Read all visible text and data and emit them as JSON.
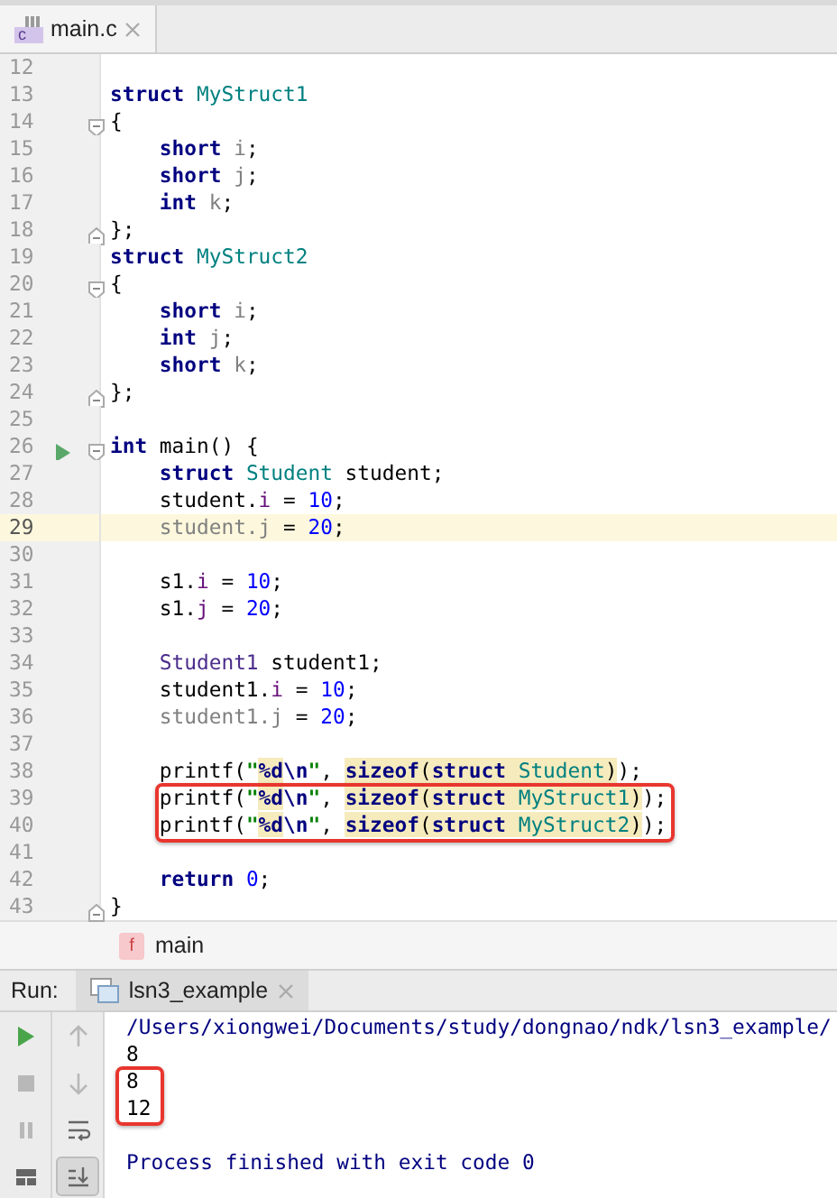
{
  "editor_tab": {
    "icon_text": "c",
    "label": "main.c",
    "selected": true
  },
  "code_lines": [
    {
      "number": "12",
      "kind": "plain",
      "current": false,
      "boxed": false
    },
    {
      "number": "13",
      "kind": "plain",
      "current": false,
      "boxed": false,
      "tokens": [
        {
          "text": "struct ",
          "kind": "kw"
        },
        {
          "text": "MyStruct1",
          "kind": "type"
        }
      ]
    },
    {
      "number": "14",
      "kind": "opener",
      "current": false,
      "boxed": false,
      "tokens": [
        {
          "text": "{",
          "kind": "plain"
        }
      ]
    },
    {
      "number": "15",
      "kind": "plain",
      "current": false,
      "boxed": false,
      "tokens": [
        {
          "text": "    short ",
          "kind": "kw"
        },
        {
          "text": "i",
          "kind": "dim"
        },
        {
          "text": ";",
          "kind": "plain"
        }
      ]
    },
    {
      "number": "16",
      "kind": "plain",
      "current": false,
      "boxed": false,
      "tokens": [
        {
          "text": "    short ",
          "kind": "kw"
        },
        {
          "text": "j",
          "kind": "dim"
        },
        {
          "text": ";",
          "kind": "plain"
        }
      ]
    },
    {
      "number": "17",
      "kind": "plain",
      "current": false,
      "boxed": false,
      "tokens": [
        {
          "text": "    int ",
          "kind": "kw"
        },
        {
          "text": "k",
          "kind": "dim"
        },
        {
          "text": ";",
          "kind": "plain"
        }
      ]
    },
    {
      "number": "18",
      "kind": "closer",
      "current": false,
      "boxed": false,
      "tokens": [
        {
          "text": "};",
          "kind": "plain"
        }
      ]
    },
    {
      "number": "19",
      "kind": "plain",
      "current": false,
      "boxed": false,
      "tokens": [
        {
          "text": "struct ",
          "kind": "kw"
        },
        {
          "text": "MyStruct2",
          "kind": "type"
        }
      ]
    },
    {
      "number": "20",
      "kind": "opener",
      "current": false,
      "boxed": false,
      "tokens": [
        {
          "text": "{",
          "kind": "plain"
        }
      ]
    },
    {
      "number": "21",
      "kind": "plain",
      "current": false,
      "boxed": false,
      "tokens": [
        {
          "text": "    short ",
          "kind": "kw"
        },
        {
          "text": "i",
          "kind": "dim"
        },
        {
          "text": ";",
          "kind": "plain"
        }
      ]
    },
    {
      "number": "22",
      "kind": "plain",
      "current": false,
      "boxed": false,
      "tokens": [
        {
          "text": "    int ",
          "kind": "kw"
        },
        {
          "text": "j",
          "kind": "dim"
        },
        {
          "text": ";",
          "kind": "plain"
        }
      ]
    },
    {
      "number": "23",
      "kind": "plain",
      "current": false,
      "boxed": false,
      "tokens": [
        {
          "text": "    short ",
          "kind": "kw"
        },
        {
          "text": "k",
          "kind": "dim"
        },
        {
          "text": ";",
          "kind": "plain"
        }
      ]
    },
    {
      "number": "24",
      "kind": "closer",
      "current": false,
      "boxed": false,
      "tokens": [
        {
          "text": "};",
          "kind": "plain"
        }
      ]
    },
    {
      "number": "25",
      "kind": "plain",
      "current": false,
      "boxed": false
    },
    {
      "number": "26",
      "kind": "opener",
      "current": false,
      "boxed": false,
      "run": true,
      "tokens": [
        {
          "text": "int",
          "kind": "kw"
        },
        {
          "text": " main() {",
          "kind": "plain"
        }
      ]
    },
    {
      "number": "27",
      "kind": "plain",
      "current": false,
      "boxed": false,
      "tokens": [
        {
          "text": "    struct ",
          "kind": "kw"
        },
        {
          "text": "Student",
          "kind": "type"
        },
        {
          "text": " student;",
          "kind": "plain"
        }
      ]
    },
    {
      "number": "28",
      "kind": "plain",
      "current": false,
      "boxed": false,
      "tokens": [
        {
          "text": "    student.",
          "kind": "plain"
        },
        {
          "text": "i",
          "kind": "field"
        },
        {
          "text": " = ",
          "kind": "plain"
        },
        {
          "text": "10",
          "kind": "num"
        },
        {
          "text": ";",
          "kind": "plain"
        }
      ]
    },
    {
      "number": "29",
      "kind": "plain",
      "current": true,
      "boxed": false,
      "tokens": [
        {
          "text": "    student.j",
          "kind": "dim"
        },
        {
          "text": " = ",
          "kind": "plain"
        },
        {
          "text": "20",
          "kind": "num"
        },
        {
          "text": ";",
          "kind": "plain"
        }
      ]
    },
    {
      "number": "30",
      "kind": "plain",
      "current": false,
      "boxed": false
    },
    {
      "number": "31",
      "kind": "plain",
      "current": false,
      "boxed": false,
      "tokens": [
        {
          "text": "    s1.",
          "kind": "plain"
        },
        {
          "text": "i",
          "kind": "field"
        },
        {
          "text": " = ",
          "kind": "plain"
        },
        {
          "text": "10",
          "kind": "num"
        },
        {
          "text": ";",
          "kind": "plain"
        }
      ]
    },
    {
      "number": "32",
      "kind": "plain",
      "current": false,
      "boxed": false,
      "tokens": [
        {
          "text": "    s1.",
          "kind": "plain"
        },
        {
          "text": "j",
          "kind": "field"
        },
        {
          "text": " = ",
          "kind": "plain"
        },
        {
          "text": "20",
          "kind": "num"
        },
        {
          "text": ";",
          "kind": "plain"
        }
      ]
    },
    {
      "number": "33",
      "kind": "plain",
      "current": false,
      "boxed": false
    },
    {
      "number": "34",
      "kind": "plain",
      "current": false,
      "boxed": false,
      "tokens": [
        {
          "text": "    Student1",
          "kind": "alias"
        },
        {
          "text": " student1;",
          "kind": "plain"
        }
      ]
    },
    {
      "number": "35",
      "kind": "plain",
      "current": false,
      "boxed": false,
      "tokens": [
        {
          "text": "    student1.",
          "kind": "plain"
        },
        {
          "text": "i",
          "kind": "field"
        },
        {
          "text": " = ",
          "kind": "plain"
        },
        {
          "text": "10",
          "kind": "num"
        },
        {
          "text": ";",
          "kind": "plain"
        }
      ]
    },
    {
      "number": "36",
      "kind": "plain",
      "current": false,
      "boxed": false,
      "tokens": [
        {
          "text": "    student1.j",
          "kind": "dim"
        },
        {
          "text": " = ",
          "kind": "plain"
        },
        {
          "text": "20",
          "kind": "num"
        },
        {
          "text": ";",
          "kind": "plain"
        }
      ]
    },
    {
      "number": "37",
      "kind": "plain",
      "current": false,
      "boxed": false
    },
    {
      "number": "38",
      "kind": "plain",
      "current": false,
      "boxed": false,
      "tokens": [
        {
          "text": "    printf(",
          "kind": "plain"
        },
        {
          "text": "\"",
          "kind": "str"
        },
        {
          "text": "%d",
          "kind": "escmark"
        },
        {
          "text": "\\n",
          "kind": "esc"
        },
        {
          "text": "\"",
          "kind": "str"
        },
        {
          "text": ", ",
          "kind": "plain"
        },
        {
          "text": "sizeof",
          "kind": "kwmark"
        },
        {
          "text": "(",
          "kind": "plainmark"
        },
        {
          "text": "struct ",
          "kind": "kwmark"
        },
        {
          "text": "Student",
          "kind": "typemark"
        },
        {
          "text": ")",
          "kind": "plainmark"
        },
        {
          "text": ");",
          "kind": "plain"
        }
      ]
    },
    {
      "number": "39",
      "kind": "plain",
      "current": false,
      "boxed": true,
      "tokens": [
        {
          "text": "    printf(",
          "kind": "plain"
        },
        {
          "text": "\"",
          "kind": "str"
        },
        {
          "text": "%d",
          "kind": "escmark"
        },
        {
          "text": "\\n",
          "kind": "esc"
        },
        {
          "text": "\"",
          "kind": "str"
        },
        {
          "text": ", ",
          "kind": "plain"
        },
        {
          "text": "sizeof",
          "kind": "kwmark"
        },
        {
          "text": "(",
          "kind": "plainmark"
        },
        {
          "text": "struct ",
          "kind": "kwmark"
        },
        {
          "text": "MyStruct1",
          "kind": "typemark"
        },
        {
          "text": ")",
          "kind": "plainmark"
        },
        {
          "text": ");",
          "kind": "plain"
        }
      ]
    },
    {
      "number": "40",
      "kind": "plain",
      "current": false,
      "boxed": true,
      "tokens": [
        {
          "text": "    printf(",
          "kind": "plain"
        },
        {
          "text": "\"",
          "kind": "str"
        },
        {
          "text": "%d",
          "kind": "escmark"
        },
        {
          "text": "\\n",
          "kind": "esc"
        },
        {
          "text": "\"",
          "kind": "str"
        },
        {
          "text": ", ",
          "kind": "plain"
        },
        {
          "text": "sizeof",
          "kind": "kwmark"
        },
        {
          "text": "(",
          "kind": "plainmark"
        },
        {
          "text": "struct ",
          "kind": "kwmark"
        },
        {
          "text": "MyStruct2",
          "kind": "typemark"
        },
        {
          "text": ")",
          "kind": "plainmark"
        },
        {
          "text": ");",
          "kind": "plain"
        }
      ]
    },
    {
      "number": "41",
      "kind": "plain",
      "current": false,
      "boxed": false
    },
    {
      "number": "42",
      "kind": "plain",
      "current": false,
      "boxed": false,
      "tokens": [
        {
          "text": "    return ",
          "kind": "kw"
        },
        {
          "text": "0",
          "kind": "num"
        },
        {
          "text": ";",
          "kind": "plain"
        }
      ]
    },
    {
      "number": "43",
      "kind": "closer",
      "current": false,
      "boxed": false,
      "tokens": [
        {
          "text": "}",
          "kind": "plain"
        }
      ]
    }
  ],
  "breadcrumb": {
    "icon_text": "f",
    "label": "main"
  },
  "run_panel": {
    "label": "Run:",
    "tab": {
      "label": "lsn3_example",
      "selected": true
    },
    "toolbar": [
      {
        "kind": "run",
        "disabled": false,
        "pressed": false
      },
      {
        "kind": "up",
        "disabled": true,
        "pressed": false
      },
      {
        "kind": "stop",
        "disabled": true,
        "pressed": false
      },
      {
        "kind": "down",
        "disabled": true,
        "pressed": false
      },
      {
        "kind": "pause",
        "disabled": true,
        "pressed": false
      },
      {
        "kind": "wrap",
        "disabled": false,
        "pressed": false
      },
      {
        "kind": "layout",
        "disabled": false,
        "pressed": false
      },
      {
        "kind": "scroll",
        "disabled": false,
        "pressed": true
      }
    ],
    "output": [
      {
        "kind": "path",
        "text": "/Users/xiongwei/Documents/study/dongnao/ndk/lsn3_example/",
        "boxed": false
      },
      {
        "kind": "out",
        "text": "8",
        "boxed": false
      },
      {
        "kind": "out",
        "text": "8",
        "boxed": true
      },
      {
        "kind": "out",
        "text": "12",
        "boxed": true
      },
      {
        "kind": "blank",
        "boxed": false
      },
      {
        "kind": "info",
        "text": "Process finished with exit code 0",
        "boxed": false
      }
    ]
  }
}
